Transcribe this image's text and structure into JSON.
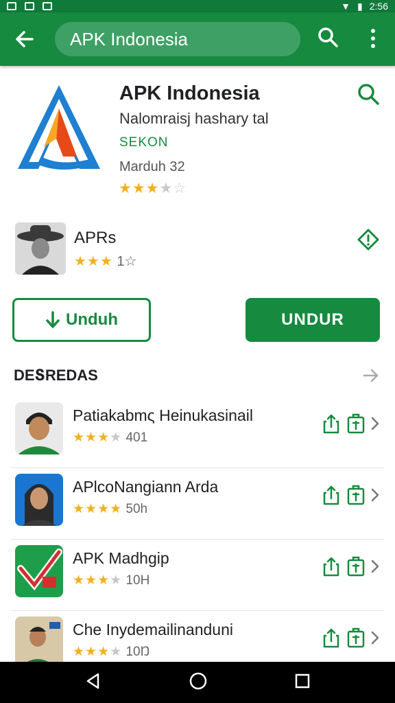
{
  "status_bar": {
    "time": "2:56"
  },
  "toolbar": {
    "search_text": "APK Indonesia"
  },
  "app": {
    "title": "APK Indonesia",
    "subtitle": "Nalomraisj hashary tal",
    "developer": "SEKON",
    "meta": "Marduh 32",
    "rating": 3.5,
    "stars": "★★★",
    "stars_off": "★☆"
  },
  "related": {
    "name": "APRs",
    "stars": "★★★",
    "count": "1☆"
  },
  "buttons": {
    "download": "Unduh",
    "primary": "UNDUR"
  },
  "section": {
    "title": "DEՏREDAS"
  },
  "list": [
    {
      "name": "Patiakabmς Heinukasinail",
      "stars": "★★★",
      "stars_off": "★",
      "count": "401",
      "icon": "man-avatar-icon"
    },
    {
      "name": "APlcoNangiann Arda",
      "stars": "★★★★",
      "stars_off": "",
      "count": "50h",
      "icon": "woman-avatar-icon"
    },
    {
      "name": "APK Madhgip",
      "stars": "★★★",
      "stars_off": "★",
      "count": "10H",
      "icon": "checkmark-app-icon"
    },
    {
      "name": "Che Inydemailinanduni",
      "stars": "★★★",
      "stars_off": "★",
      "count": "10Ŋ",
      "icon": "official-avatar-icon"
    }
  ],
  "colors": {
    "primary": "#168a3f",
    "star": "#f2b01e"
  }
}
